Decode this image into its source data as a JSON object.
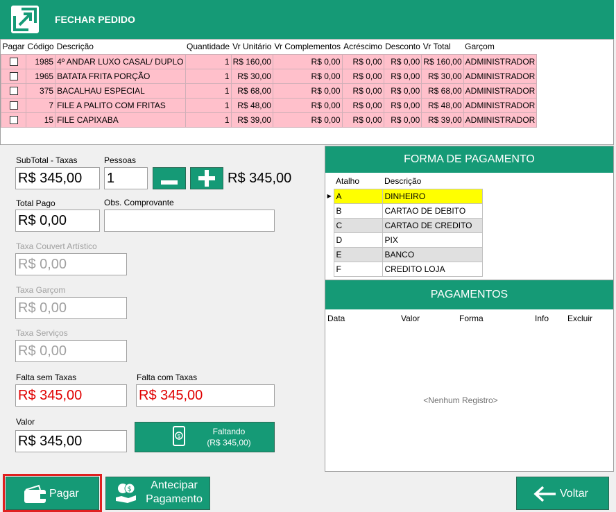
{
  "window": {
    "title": "FECHAR PEDIDO"
  },
  "colors": {
    "accent": "#159a76",
    "row_pink": "#ffc0cb",
    "selected": "#ffff00",
    "missing_red": "#e00000"
  },
  "items_table": {
    "headers": [
      "Pagar",
      "Código",
      "Descrição",
      "Quantidade",
      "Vr Unitário",
      "Vr Complementos",
      "Acréscimo",
      "Desconto",
      "Vr Total",
      "Garçom"
    ],
    "rows": [
      {
        "code": "1985",
        "description": "4º ANDAR LUXO CASAL/ DUPLO",
        "qty": "1",
        "unit": "R$ 160,00",
        "compl": "R$ 0,00",
        "acresc": "R$ 0,00",
        "desc": "R$ 0,00",
        "total": "R$ 160,00",
        "waiter": "ADMINISTRADOR"
      },
      {
        "code": "1965",
        "description": "BATATA FRITA PORÇÃO",
        "qty": "1",
        "unit": "R$ 30,00",
        "compl": "R$ 0,00",
        "acresc": "R$ 0,00",
        "desc": "R$ 0,00",
        "total": "R$ 30,00",
        "waiter": "ADMINISTRADOR"
      },
      {
        "code": "375",
        "description": "BACALHAU ESPECIAL",
        "qty": "1",
        "unit": "R$ 68,00",
        "compl": "R$ 0,00",
        "acresc": "R$ 0,00",
        "desc": "R$ 0,00",
        "total": "R$ 68,00",
        "waiter": "ADMINISTRADOR"
      },
      {
        "code": "7",
        "description": "FILE A PALITO COM FRITAS",
        "qty": "1",
        "unit": "R$ 48,00",
        "compl": "R$ 0,00",
        "acresc": "R$ 0,00",
        "desc": "R$ 0,00",
        "total": "R$ 48,00",
        "waiter": "ADMINISTRADOR"
      },
      {
        "code": "15",
        "description": "FILE CAPIXABA",
        "qty": "1",
        "unit": "R$ 39,00",
        "compl": "R$ 0,00",
        "acresc": "R$ 0,00",
        "desc": "R$ 0,00",
        "total": "R$ 39,00",
        "waiter": "ADMINISTRADOR"
      }
    ]
  },
  "form": {
    "subtotal_label": "SubTotal - Taxas",
    "subtotal_value": "R$ 345,00",
    "pessoas_label": "Pessoas",
    "pessoas_value": "1",
    "minus": "−",
    "plus": "+",
    "per_person": "R$ 345,00",
    "total_pago_label": "Total Pago",
    "total_pago_value": "R$ 0,00",
    "obs_label": "Obs. Comprovante",
    "obs_value": "",
    "couvert_label": "Taxa Couvert Artístico",
    "couvert_value": "R$ 0,00",
    "garcom_label": "Taxa Garçom",
    "garcom_value": "R$ 0,00",
    "servicos_label": "Taxa Serviços",
    "servicos_value": "R$ 0,00",
    "falta_sem_label": "Falta sem Taxas",
    "falta_sem_value": "R$ 345,00",
    "falta_com_label": "Falta com Taxas",
    "falta_com_value": "R$ 345,00",
    "valor_label": "Valor",
    "valor_value": "R$ 345,00",
    "faltando_line1": "Faltando",
    "faltando_line2": "(R$ 345,00)"
  },
  "forma_pagamento": {
    "title": "FORMA DE PAGAMENTO",
    "headers": [
      "Atalho",
      "Descrição"
    ],
    "rows": [
      {
        "key": "A",
        "label": "DINHEIRO"
      },
      {
        "key": "B",
        "label": "CARTAO DE DEBITO"
      },
      {
        "key": "C",
        "label": "CARTAO DE CREDITO"
      },
      {
        "key": "D",
        "label": "PIX"
      },
      {
        "key": "E",
        "label": "BANCO"
      },
      {
        "key": "F",
        "label": "CREDITO LOJA"
      }
    ]
  },
  "pagamentos": {
    "title": "PAGAMENTOS",
    "headers": [
      "Data",
      "Valor",
      "Forma",
      "Info",
      "Excluir"
    ],
    "empty": "<Nenhum Registro>"
  },
  "buttons": {
    "pagar": "Pagar",
    "antecipar_line1": "Antecipar",
    "antecipar_line2": "Pagamento",
    "voltar": "Voltar"
  },
  "icons": {
    "logo": "arrow-logo-icon",
    "wallet": "wallet-icon",
    "money_hand": "money-hand-icon",
    "back_arrow": "arrow-left-icon",
    "phone_money": "phone-money-icon"
  }
}
